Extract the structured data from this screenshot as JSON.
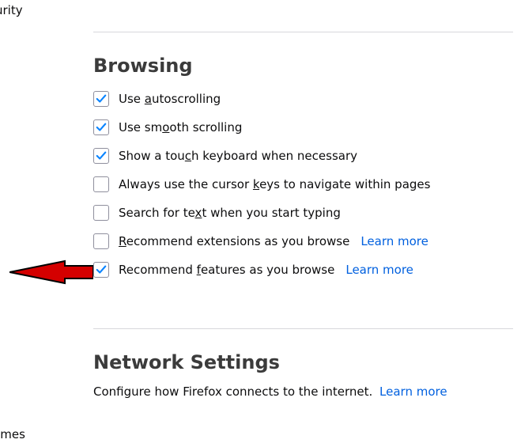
{
  "sidebar": {
    "item_security_fragment": "urity",
    "item_themes_fragment": "emes"
  },
  "browsing": {
    "title": "Browsing",
    "opts": [
      {
        "pre": "Use ",
        "u": "a",
        "post": "utoscrolling",
        "checked": true
      },
      {
        "pre": "Use sm",
        "u": "o",
        "post": "oth scrolling",
        "checked": true
      },
      {
        "pre": "Show a tou",
        "u": "c",
        "post": "h keyboard when necessary",
        "checked": true
      },
      {
        "pre": "Always use the cursor ",
        "u": "k",
        "post": "eys to navigate within pages",
        "checked": false
      },
      {
        "pre": "Search for te",
        "u": "x",
        "post": "t when you start typing",
        "checked": false
      },
      {
        "pre": "",
        "u": "R",
        "post": "ecommend extensions as you browse",
        "checked": false,
        "learn": "Learn more"
      },
      {
        "pre": "Recommend ",
        "u": "f",
        "post": "eatures as you browse",
        "checked": true,
        "learn": "Learn more"
      }
    ]
  },
  "network": {
    "title": "Network Settings",
    "desc": "Configure how Firefox connects to the internet.",
    "learn": "Learn more"
  }
}
